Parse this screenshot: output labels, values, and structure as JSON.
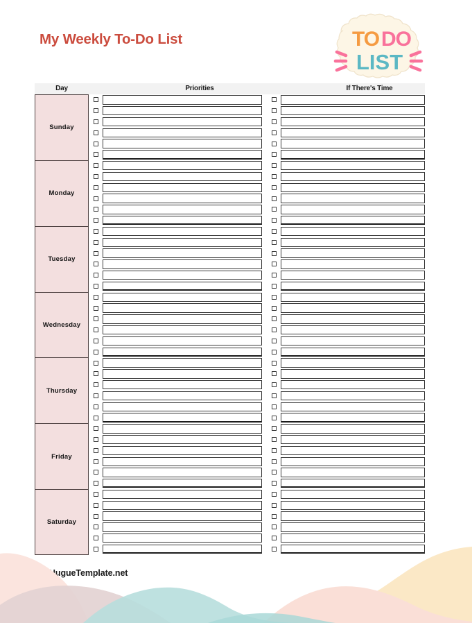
{
  "document": {
    "title": "My Weekly To-Do List",
    "title_color": "#cb4c3e",
    "footer": "HugueTemplate.net",
    "background": "#ffffff"
  },
  "logo": {
    "line1_word1": "TO",
    "line1_word2": "DO",
    "line2": "LIST",
    "word1_color": "#f59b42",
    "word2_color": "#f9729b",
    "line2_color": "#5bb8c4",
    "sticker_color": "#fdf6e6",
    "dash_color": "#f9729b"
  },
  "table": {
    "headers": {
      "day": "Day",
      "priorities": "Priorities",
      "if_theres_time": "If There's Time"
    },
    "header_background": "#f2f2f2",
    "day_cell_color": "#f3dfdf",
    "border_color": "#4d4040",
    "rows_per_day": 6,
    "days": [
      {
        "label": "Sunday"
      },
      {
        "label": "Monday"
      },
      {
        "label": "Tuesday"
      },
      {
        "label": "Wednesday"
      },
      {
        "label": "Thursday"
      },
      {
        "label": "Friday"
      },
      {
        "label": "Saturday"
      }
    ]
  },
  "waves": {
    "colors": [
      "#fbe4de",
      "#e3d3d2",
      "#b7dedd",
      "#fadfd7",
      "#fbe8c6"
    ]
  }
}
